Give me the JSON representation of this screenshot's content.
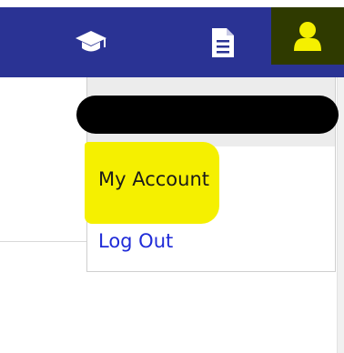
{
  "navbar": {
    "background": "#2a3394",
    "icon_color": "#ffffff",
    "active_icon_color": "#f5f000",
    "items": [
      {
        "icon": "graduation-cap-icon"
      },
      {
        "icon": "document-icon"
      },
      {
        "icon": "user-icon",
        "active": true
      }
    ]
  },
  "account_menu": {
    "username_redacted": true,
    "items": [
      {
        "label": "My Account",
        "highlighted": true
      },
      {
        "label": "Log Out"
      }
    ]
  }
}
